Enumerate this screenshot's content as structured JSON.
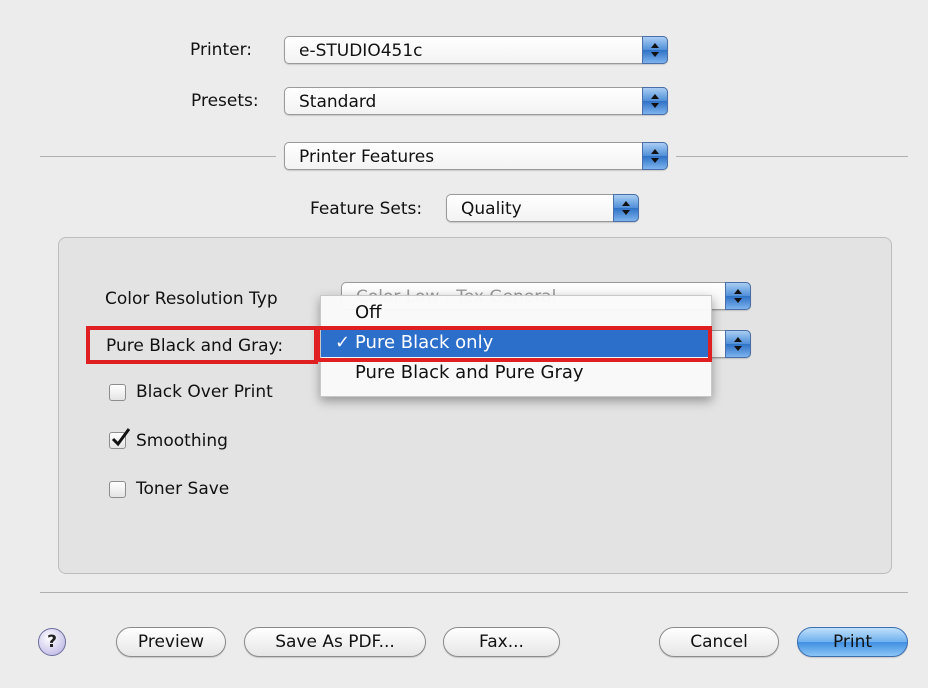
{
  "printer": {
    "label": "Printer:",
    "value": "e-STUDIO451c"
  },
  "presets": {
    "label": "Presets:",
    "value": "Standard"
  },
  "pane": {
    "value": "Printer Features"
  },
  "feature_sets": {
    "label": "Feature Sets:",
    "value": "Quality"
  },
  "color_resolution": {
    "label": "Color Resolution Typ",
    "value": "Color Low - Tex General"
  },
  "pure_black_gray": {
    "label": "Pure Black and Gray:",
    "menu": {
      "options": [
        "Off",
        "Pure Black only",
        "Pure Black and Pure Gray"
      ],
      "check_glyph": "✓"
    }
  },
  "checkboxes": [
    {
      "label": "Black Over Print",
      "checked": false
    },
    {
      "label": "Smoothing",
      "checked": true
    },
    {
      "label": "Toner Save",
      "checked": false
    }
  ],
  "buttons": {
    "help": "?",
    "preview": "Preview",
    "save_pdf": "Save As PDF...",
    "fax": "Fax...",
    "cancel": "Cancel",
    "print": "Print"
  },
  "colors": {
    "highlight": "#e02020",
    "selection": "#2c6fcb"
  }
}
